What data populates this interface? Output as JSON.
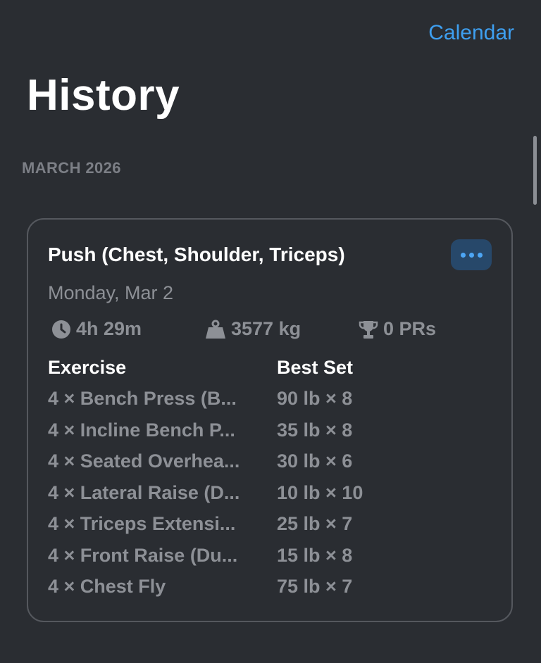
{
  "nav": {
    "calendar_label": "Calendar"
  },
  "page": {
    "title": "History"
  },
  "section": {
    "header": "MARCH 2026"
  },
  "workout": {
    "title": "Push (Chest, Shoulder, Triceps)",
    "date": "Monday, Mar 2",
    "more_icon": "ellipsis-icon",
    "stats": {
      "duration": {
        "icon": "clock-icon",
        "value": "4h 29m"
      },
      "volume": {
        "icon": "weight-icon",
        "value": "3577 kg"
      },
      "prs": {
        "icon": "trophy-icon",
        "value": "0 PRs"
      }
    },
    "table": {
      "headers": {
        "exercise": "Exercise",
        "best_set": "Best Set"
      },
      "rows": [
        {
          "exercise": "4 × Bench Press (B...",
          "best_set": "90 lb × 8"
        },
        {
          "exercise": "4 × Incline Bench P...",
          "best_set": "35 lb × 8"
        },
        {
          "exercise": "4 × Seated Overhea...",
          "best_set": "30 lb × 6"
        },
        {
          "exercise": "4 × Lateral Raise (D...",
          "best_set": "10 lb × 10"
        },
        {
          "exercise": "4 × Triceps Extensi...",
          "best_set": "25 lb × 7"
        },
        {
          "exercise": "4 × Front Raise (Du...",
          "best_set": "15 lb × 8"
        },
        {
          "exercise": "4 × Chest Fly",
          "best_set": "75 lb × 7"
        }
      ]
    }
  },
  "colors": {
    "background": "#2a2d32",
    "accent": "#3e9ff0",
    "secondary_text": "#8d9096"
  }
}
